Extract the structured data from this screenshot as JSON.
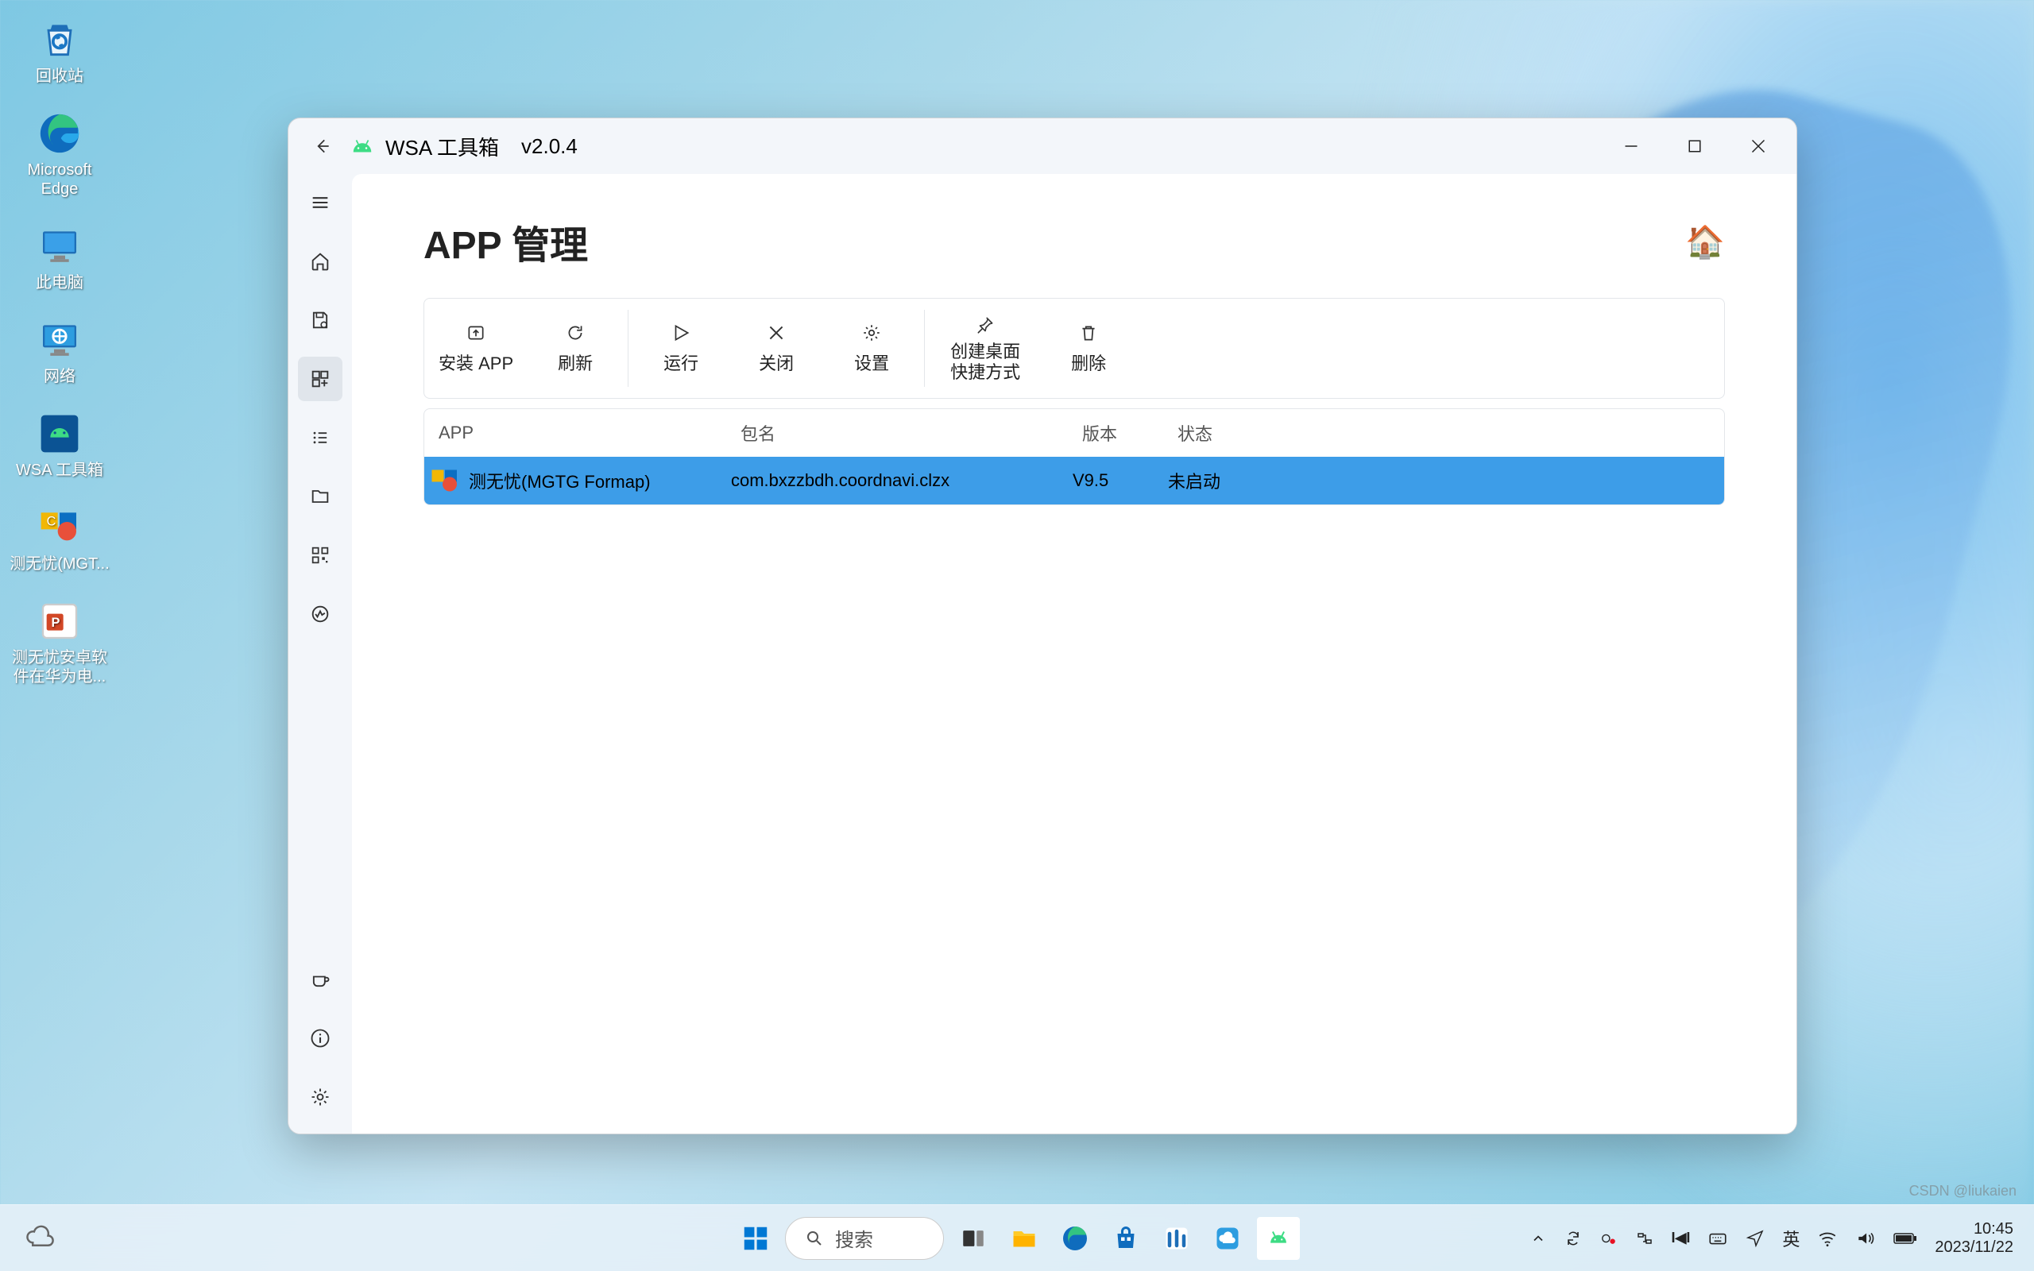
{
  "desktop": {
    "icons": [
      {
        "name": "recycle-bin",
        "label": "回收站"
      },
      {
        "name": "edge",
        "label": "Microsoft Edge"
      },
      {
        "name": "this-pc",
        "label": "此电脑"
      },
      {
        "name": "network",
        "label": "网络"
      },
      {
        "name": "wsa-toolbox",
        "label": "WSA 工具箱"
      },
      {
        "name": "cewuyou",
        "label": "测无忧(MGT..."
      },
      {
        "name": "ppt-doc",
        "label": "测无忧安卓软件在华为电..."
      }
    ]
  },
  "window": {
    "title": "WSA 工具箱",
    "version": "v2.0.4",
    "page_title": "APP 管理",
    "toolbar": [
      {
        "name": "install-app",
        "label": "安装 APP",
        "icon": "upload-icon"
      },
      {
        "name": "refresh",
        "label": "刷新",
        "icon": "refresh-icon"
      },
      {
        "name": "run",
        "label": "运行",
        "icon": "play-icon"
      },
      {
        "name": "close",
        "label": "关闭",
        "icon": "x-icon"
      },
      {
        "name": "settings",
        "label": "设置",
        "icon": "gear-icon"
      },
      {
        "name": "create-shortcut",
        "label": "创建桌面快捷方式",
        "icon": "pin-icon"
      },
      {
        "name": "delete",
        "label": "删除",
        "icon": "trash-icon"
      }
    ],
    "columns": {
      "app": "APP",
      "package": "包名",
      "version": "版本",
      "status": "状态"
    },
    "rows": [
      {
        "app": "测无忧(MGTG Formap)",
        "package": "com.bxzzbdh.coordnavi.clzx",
        "version": "V9.5",
        "status": "未启动"
      }
    ],
    "sidebar": [
      {
        "name": "menu-icon"
      },
      {
        "name": "home-icon"
      },
      {
        "name": "save-icon"
      },
      {
        "name": "apps-icon"
      },
      {
        "name": "list-icon"
      },
      {
        "name": "folder-icon"
      },
      {
        "name": "qr-icon"
      },
      {
        "name": "activity-icon"
      }
    ],
    "sidebar_bottom": [
      {
        "name": "coffee-icon"
      },
      {
        "name": "info-icon"
      },
      {
        "name": "settings-icon"
      }
    ]
  },
  "taskbar": {
    "search_placeholder": "搜索",
    "ime": "英",
    "time": "10:45",
    "date": "2023/11/22",
    "apps": [
      {
        "name": "start-icon"
      },
      {
        "name": "task-view-icon"
      },
      {
        "name": "file-explorer-icon"
      },
      {
        "name": "edge-icon"
      },
      {
        "name": "store-icon"
      },
      {
        "name": "market-icon"
      },
      {
        "name": "cloud-icon"
      },
      {
        "name": "android-icon"
      }
    ],
    "tray": [
      {
        "name": "chevron-up-icon"
      },
      {
        "name": "sync-icon"
      },
      {
        "name": "record-icon"
      },
      {
        "name": "devices-icon"
      },
      {
        "name": "ime-mi-icon"
      },
      {
        "name": "keyboard-icon"
      },
      {
        "name": "location-icon"
      }
    ]
  },
  "watermark": "CSDN @liukaien"
}
